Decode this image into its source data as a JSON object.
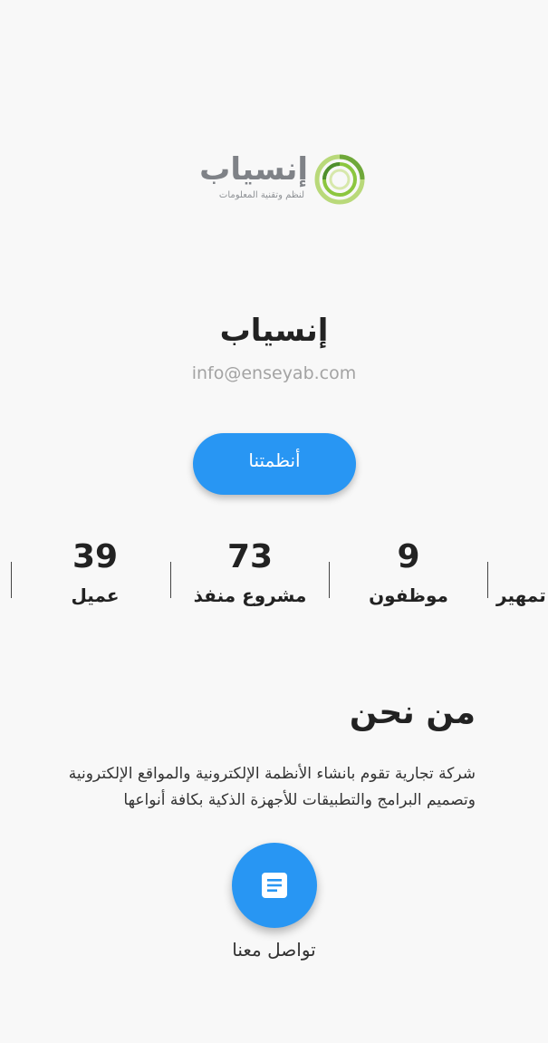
{
  "logo": {
    "wordmark": "إنسياب",
    "tagline": "لنظم وتقنية المعلومات"
  },
  "company": {
    "name": "إنسياب",
    "email": "info@enseyab.com"
  },
  "systems_button": {
    "label": "أنظمتنا"
  },
  "stats": {
    "items": [
      {
        "value": "39",
        "label": "عميل"
      },
      {
        "value": "73",
        "label": "مشروع منفذ"
      },
      {
        "value": "9",
        "label": "موظفون"
      }
    ],
    "partial_label": "تمهير"
  },
  "about": {
    "title": "من نحن",
    "text": "شركة تجارية تقوم بانشاء الأنظمة الإلكترونية والمواقع الإلكترونية وتصميم البرامج والتطبيقات للأجهزة الذكية بكافة أنواعها"
  },
  "contact": {
    "label": "تواصل معنا",
    "icon": "document-icon"
  },
  "colors": {
    "primary": "#2896f3",
    "background": "#f8f8f8",
    "logo_green": "#8cc63f",
    "logo_gray": "#7f8287"
  }
}
